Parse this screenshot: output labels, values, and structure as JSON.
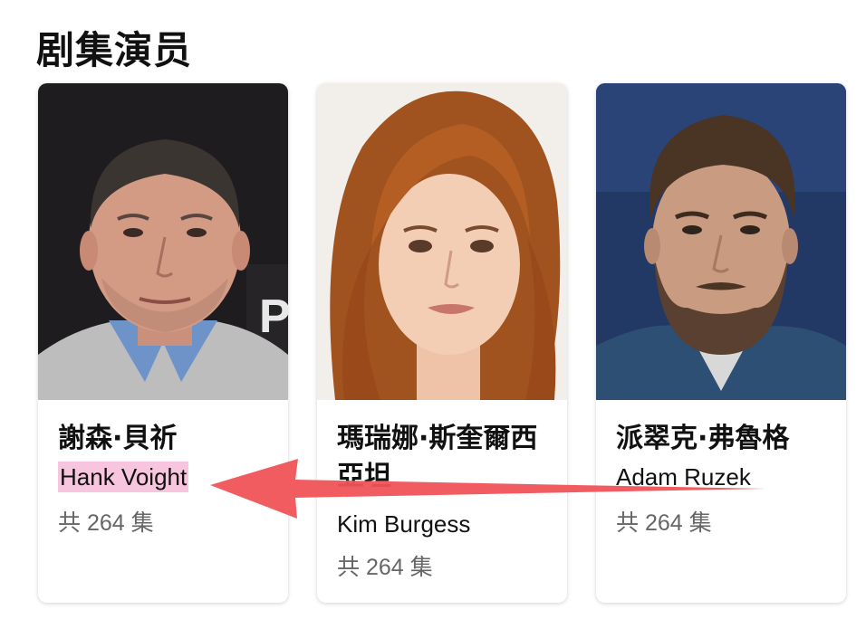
{
  "section": {
    "title": "剧集演员"
  },
  "cast": [
    {
      "name": "謝森·貝祈",
      "role": "Hank Voight",
      "episodes": "共 264 集",
      "photo_icon": "portrait-man-dark-hair"
    },
    {
      "name": "瑪瑞娜·斯奎爾西亞坦",
      "role": "Kim Burgess",
      "episodes": "共 264 集",
      "photo_icon": "portrait-woman-auburn-hair"
    },
    {
      "name": "派翠克·弗魯格",
      "role": "Adam Ruzek",
      "episodes": "共 264 集",
      "photo_icon": "portrait-man-beard"
    }
  ],
  "annotation": {
    "arrow_color": "#f05359",
    "highlight_color": "#f7c6de"
  }
}
